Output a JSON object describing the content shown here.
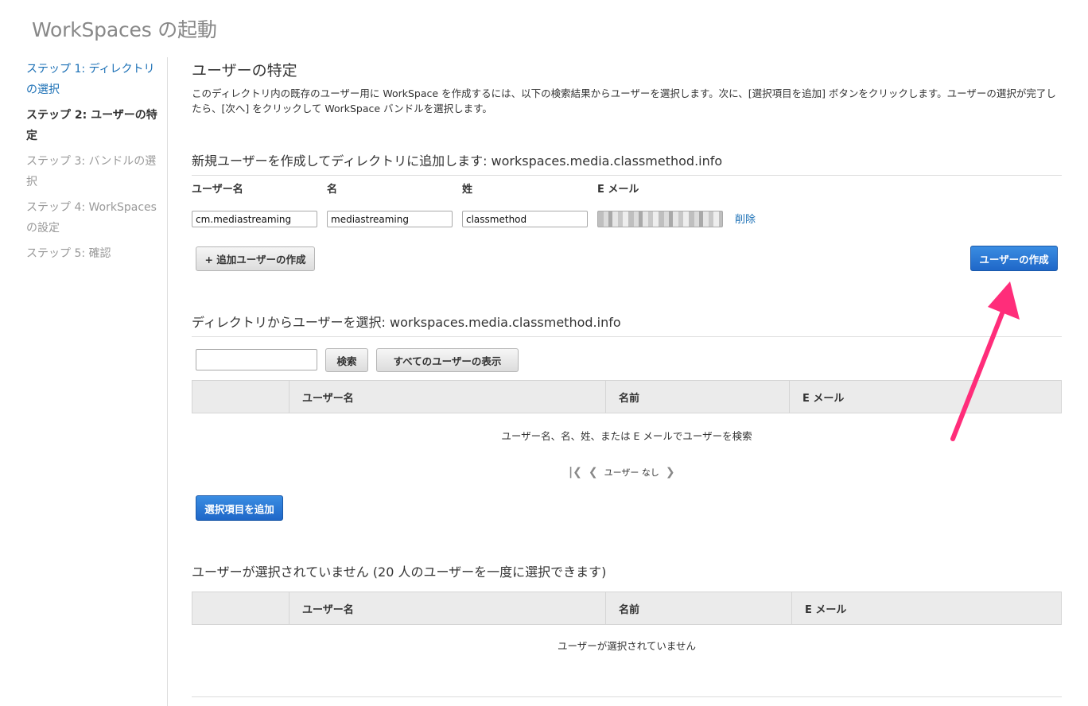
{
  "page": {
    "title": "WorkSpaces の起動"
  },
  "sidebar": {
    "steps": [
      {
        "label": "ステップ 1: ディレクトリの選択",
        "state": "done"
      },
      {
        "label": "ステップ 2: ユーザーの特定",
        "state": "current"
      },
      {
        "label": "ステップ 3: バンドルの選択",
        "state": "todo"
      },
      {
        "label": "ステップ 4: WorkSpaces の設定",
        "state": "todo"
      },
      {
        "label": "ステップ 5: 確認",
        "state": "todo"
      }
    ]
  },
  "main": {
    "heading": "ユーザーの特定",
    "intro": "このディレクトリ内の既存のユーザー用に WorkSpace を作成するには、以下の検索結果からユーザーを選択します。次に、[選択項目を追加] ボタンをクリックします。ユーザーの選択が完了したら、[次へ] をクリックして WorkSpace バンドルを選択します。"
  },
  "create_section": {
    "title": "新規ユーザーを作成してディレクトリに追加します: workspaces.media.classmethod.info",
    "columns": {
      "username": "ユーザー名",
      "first_name": "名",
      "last_name": "姓",
      "email": "E メール"
    },
    "row": {
      "username": "cm.mediastreaming",
      "first_name": "mediastreaming",
      "last_name": "classmethod",
      "email": ""
    },
    "delete_label": "削除",
    "add_more_label": "+ 追加ユーザーの作成",
    "create_label": "ユーザーの作成"
  },
  "search_section": {
    "title": "ディレクトリからユーザーを選択: workspaces.media.classmethod.info",
    "search_value": "",
    "search_label": "検索",
    "show_all_label": "すべてのユーザーの表示",
    "columns": [
      "",
      "ユーザー名",
      "名前",
      "E メール"
    ],
    "empty_message": "ユーザー名、名、姓、または E メールでユーザーを検索",
    "pager_text": "ユーザー なし",
    "add_selected_label": "選択項目を追加"
  },
  "selected_section": {
    "title": "ユーザーが選択されていません (20 人のユーザーを一度に選択できます)",
    "columns": [
      "",
      "ユーザー名",
      "名前",
      "E メール"
    ],
    "empty_message": "ユーザーが選択されていません"
  },
  "colors": {
    "accent_blue": "#1f67c8",
    "link_blue": "#1a6fb5",
    "annotation_pink": "#ff2d7a"
  },
  "icons": {
    "first_page": "first-page-icon",
    "prev_page": "chevron-left-icon",
    "next_page": "chevron-right-icon"
  }
}
